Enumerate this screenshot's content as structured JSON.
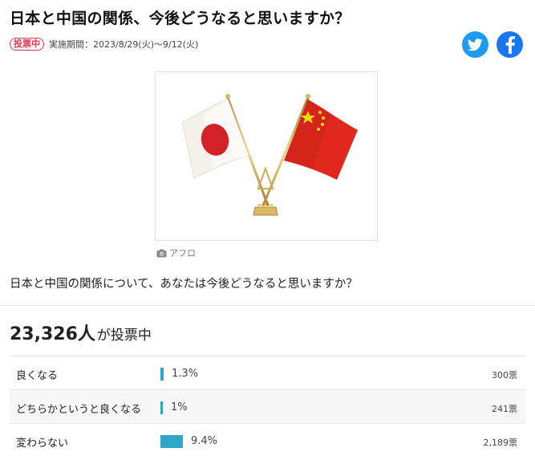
{
  "page": {
    "title": "日本と中国の関係、今後どうなると思いますか？"
  },
  "meta": {
    "status_badge": "投票中",
    "period": "実施期間：2023/8/29(火)～9/12(火)"
  },
  "share": {
    "twitter_icon": "twitter-icon",
    "facebook_icon": "facebook-icon",
    "twitter_color": "#1d9bf0",
    "facebook_color": "#1877f2"
  },
  "photo": {
    "credit": "アフロ",
    "credit_icon": "camera-icon"
  },
  "question": "日本と中国の関係について、あなたは今後どうなると思いますか？",
  "total": {
    "count": "23,326人",
    "suffix": "が投票中"
  },
  "results": [
    {
      "label": "良くなる",
      "percent_text": "1.3%",
      "percent": 1.3,
      "votes": "300票"
    },
    {
      "label": "どちらかというと良くなる",
      "percent_text": "1%",
      "percent": 1.0,
      "votes": "241票"
    },
    {
      "label": "変わらない",
      "percent_text": "9.4%",
      "percent": 9.4,
      "votes": "2,189票"
    }
  ],
  "colors": {
    "accent_bar": "#2ea5c9",
    "badge": "#e0364f"
  }
}
